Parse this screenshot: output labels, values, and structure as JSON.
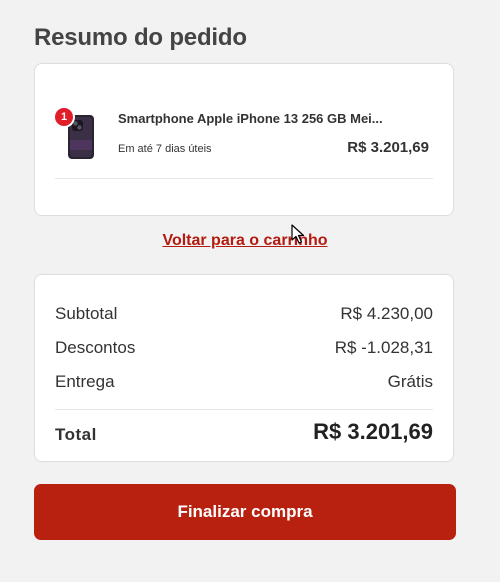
{
  "summary": {
    "title": "Resumo do pedido"
  },
  "product": {
    "name": "Smartphone Apple iPhone 13 256 GB Mei...",
    "delivery": "Em até 7 dias úteis",
    "price": "R$ 3.201,69",
    "quantity": "1",
    "thumbnail_icon": "phone-thumbnail-icon"
  },
  "links": {
    "back_to_cart": "Voltar para o carrinho"
  },
  "totals": {
    "subtotal_label": "Subtotal",
    "subtotal_value": "R$ 4.230,00",
    "discounts_label": "Descontos",
    "discounts_value": "R$ -1.028,31",
    "shipping_label": "Entrega",
    "shipping_value": "Grátis",
    "total_label": "Total",
    "total_value": "R$ 3.201,69"
  },
  "checkout": {
    "button_label": "Finalizar compra"
  },
  "colors": {
    "accent": "#b8200f",
    "badge": "#e01e2a",
    "link": "#b31b10"
  }
}
